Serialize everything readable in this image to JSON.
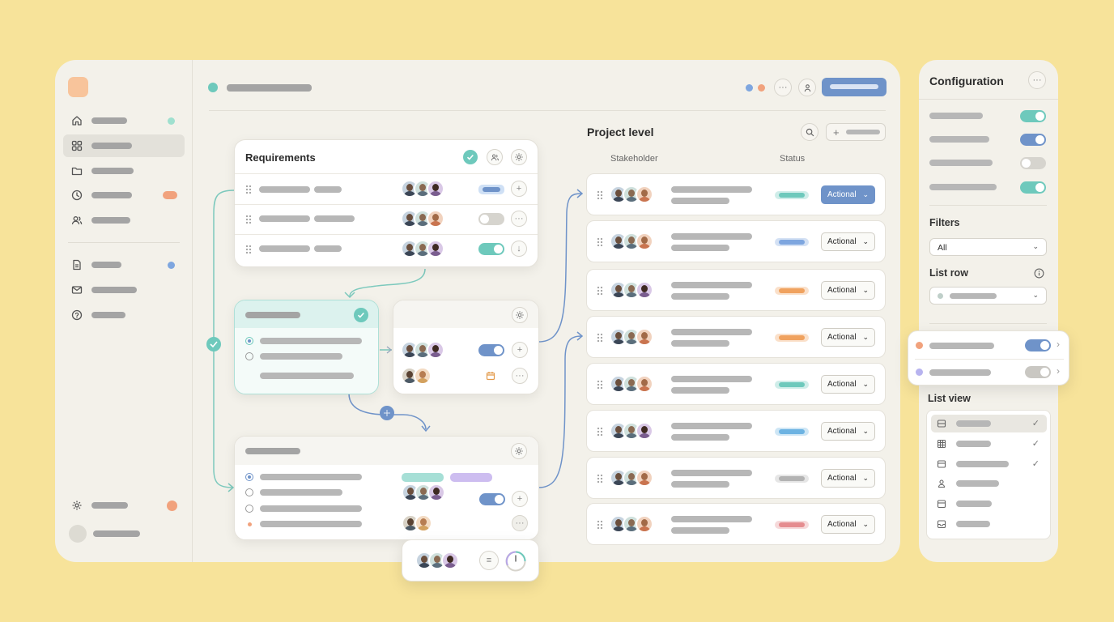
{
  "colors": {
    "background": "#f7e39a",
    "accent_blue": "#6f93c9",
    "accent_teal": "#6ec9bc",
    "accent_orange": "#f1a27d",
    "accent_purple": "#b7a6e6",
    "status_red": "#e58c8f",
    "status_gray": "#b3b3b3"
  },
  "sidebar": {
    "items": [
      {
        "icon": "home-icon"
      },
      {
        "icon": "grid-icon",
        "active": true
      },
      {
        "icon": "folder-icon"
      },
      {
        "icon": "clock-icon"
      },
      {
        "icon": "users-icon"
      },
      {
        "icon": "document-icon"
      },
      {
        "icon": "mail-icon"
      },
      {
        "icon": "help-icon"
      }
    ],
    "footer_icon": "gear-icon"
  },
  "header": {
    "icons": [
      "more-icon",
      "user-badge-icon"
    ]
  },
  "requirements": {
    "title": "Requirements"
  },
  "project": {
    "title": "Project level",
    "columns": {
      "stakeholder": "Stakeholder",
      "status": "Status"
    },
    "rows": [
      {
        "status_color": "#6ec9bc",
        "action": "Actional",
        "primary": true
      },
      {
        "status_color": "#7ea6df",
        "action": "Actional"
      },
      {
        "status_color": "#f0a25f",
        "action": "Actional"
      },
      {
        "status_color": "#f0a25f",
        "action": "Actional"
      },
      {
        "status_color": "#6ec9bc",
        "action": "Actional"
      },
      {
        "status_color": "#6db3e2",
        "action": "Actional"
      },
      {
        "status_color": "#b3b3b3",
        "action": "Actional"
      },
      {
        "status_color": "#e58c8f",
        "action": "Actional"
      }
    ]
  },
  "config": {
    "title": "Configuration",
    "toggles": [
      {
        "state": "on",
        "color": "teal"
      },
      {
        "state": "on",
        "color": "blue"
      },
      {
        "state": "off"
      },
      {
        "state": "on",
        "color": "teal"
      }
    ],
    "filters_label": "Filters",
    "filters_value": "All",
    "list_row_label": "List row",
    "list_view_label": "List view",
    "list_view_items": [
      {
        "icon": "list-layout-icon",
        "checked": true,
        "active": true
      },
      {
        "icon": "table-icon",
        "checked": true
      },
      {
        "icon": "card-layout-icon",
        "checked": true
      },
      {
        "icon": "person-icon"
      },
      {
        "icon": "calendar-icon"
      },
      {
        "icon": "inbox-icon"
      }
    ]
  }
}
